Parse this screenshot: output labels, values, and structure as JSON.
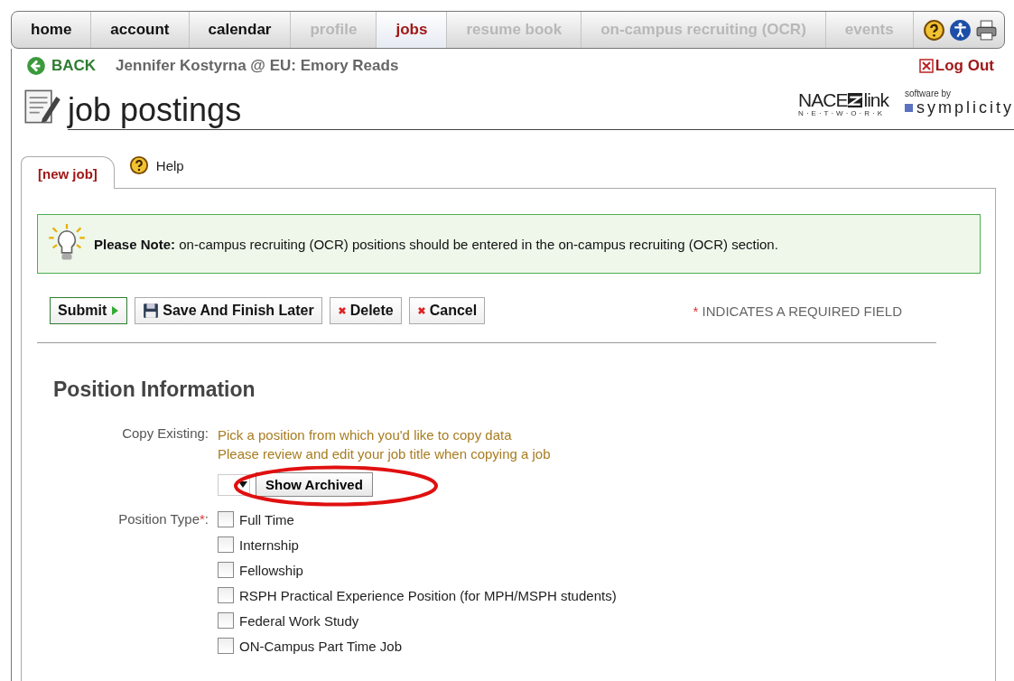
{
  "nav": {
    "tabs": [
      {
        "label": "home",
        "selected": false,
        "disabled": false
      },
      {
        "label": "account",
        "selected": false,
        "disabled": false
      },
      {
        "label": "calendar",
        "selected": false,
        "disabled": false
      },
      {
        "label": "profile",
        "selected": false,
        "disabled": true
      },
      {
        "label": "jobs",
        "selected": true,
        "disabled": false
      },
      {
        "label": "resume book",
        "selected": false,
        "disabled": true
      },
      {
        "label": "on-campus recruiting (OCR)",
        "selected": false,
        "disabled": true
      },
      {
        "label": "events",
        "selected": false,
        "disabled": true
      }
    ]
  },
  "user_bar": {
    "back": "BACK",
    "user": "Jennifer Kostyrna @ EU: Emory Reads",
    "logout": "Log Out"
  },
  "header": {
    "title": "job postings",
    "nace_logo": {
      "main": "NACE",
      "link": "link",
      "network": "N·E·T·W·O·R·K"
    },
    "symplicity_logo": {
      "tagline": "software by",
      "name": "symplicity"
    }
  },
  "tabs": [
    {
      "label": "[new job]",
      "selected": true
    },
    {
      "label": "Help",
      "selected": false
    }
  ],
  "note": {
    "lead": "Please Note:",
    "text": "on-campus recruiting (OCR) positions should be entered in the on-campus recruiting (OCR) section."
  },
  "actions": [
    {
      "label": "Submit",
      "kind": "submit"
    },
    {
      "label": "Save And Finish Later",
      "kind": "save"
    },
    {
      "label": "Delete",
      "kind": "delete"
    },
    {
      "label": "Cancel",
      "kind": "cancel"
    }
  ],
  "required_note": {
    "star": "*",
    "text": "INDICATES A REQUIRED FIELD"
  },
  "section": {
    "title": "Position Information",
    "copy_existing": {
      "label": "Copy Existing:",
      "hints": [
        "Pick a position from which you'd like to copy data",
        "Please review and edit your job title when copying a job"
      ],
      "button": "Show Archived",
      "highlighted": true
    },
    "position_type": {
      "label": "Position Type",
      "required": "*",
      "suffix": ":",
      "options": [
        {
          "label": "Full Time",
          "checked": false
        },
        {
          "label": "Internship",
          "checked": false
        },
        {
          "label": "Fellowship",
          "checked": false
        },
        {
          "label": "RSPH Practical Experience Position (for MPH/MSPH students)",
          "checked": false
        },
        {
          "label": "Federal Work Study",
          "checked": false
        },
        {
          "label": "ON-Campus Part Time Job",
          "checked": false
        }
      ]
    }
  }
}
